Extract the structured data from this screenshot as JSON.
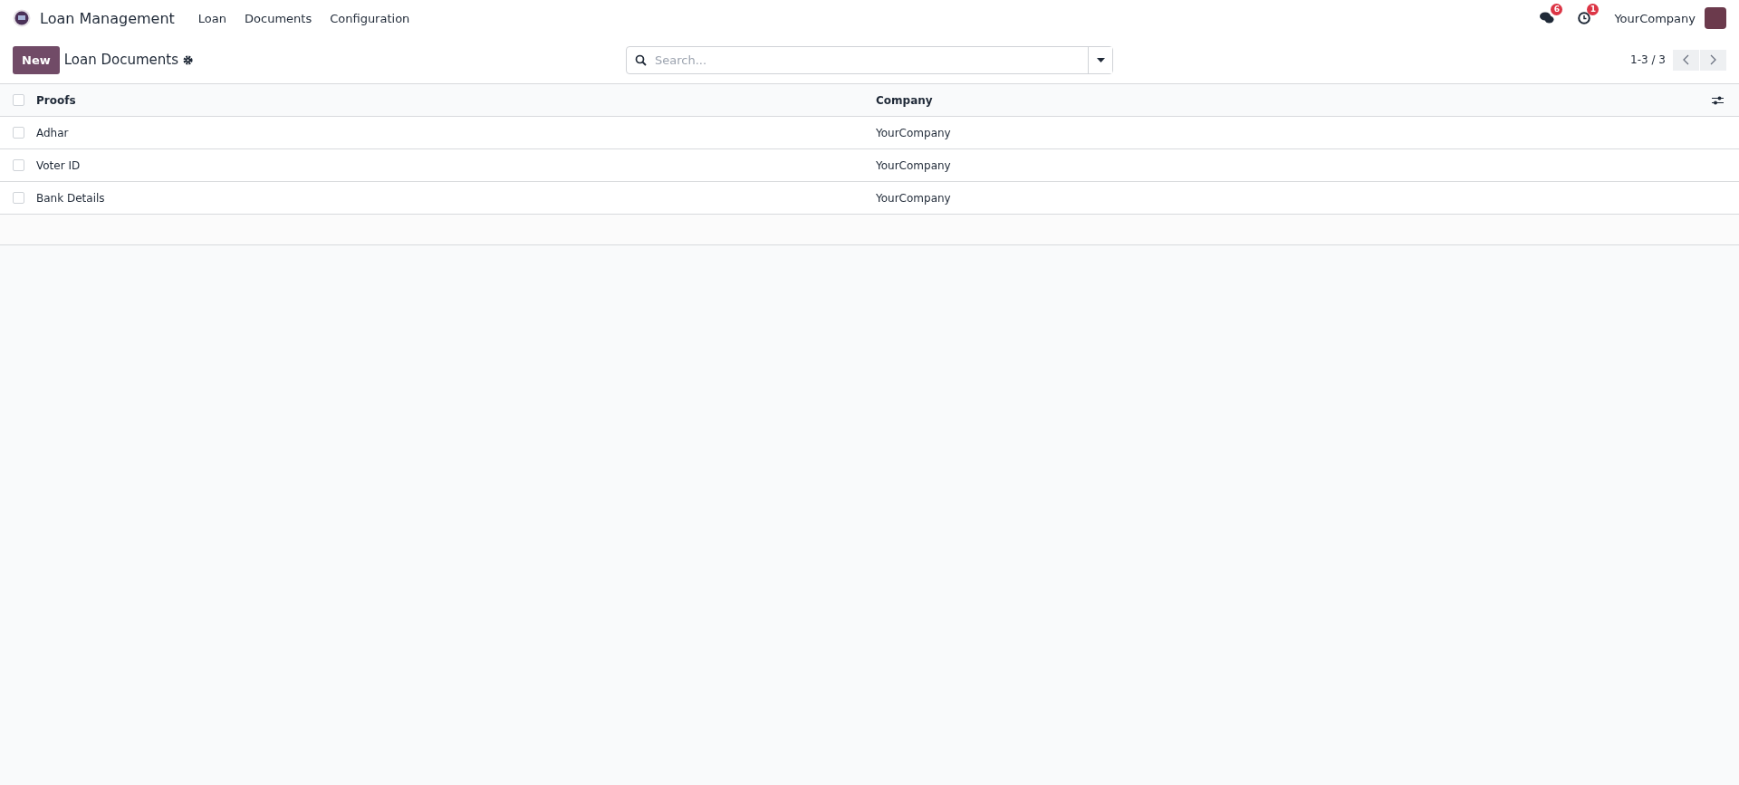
{
  "navbar": {
    "app_name": "Loan Management",
    "menu": [
      "Loan",
      "Documents",
      "Configuration"
    ],
    "messages_badge": "6",
    "activities_badge": "1",
    "company": "YourCompany"
  },
  "control_panel": {
    "new_button": "New",
    "title": "Loan Documents",
    "search": {
      "placeholder": "Search..."
    },
    "pager": "1-3 / 3"
  },
  "table": {
    "columns": [
      "Proofs",
      "Company"
    ],
    "select_all_checked": false,
    "rows": [
      {
        "cells": [
          "Adhar",
          "YourCompany"
        ],
        "checked": false
      },
      {
        "cells": [
          "Voter ID",
          "YourCompany"
        ],
        "checked": false
      },
      {
        "cells": [
          "Bank Details",
          "YourCompany"
        ],
        "checked": false
      }
    ]
  }
}
